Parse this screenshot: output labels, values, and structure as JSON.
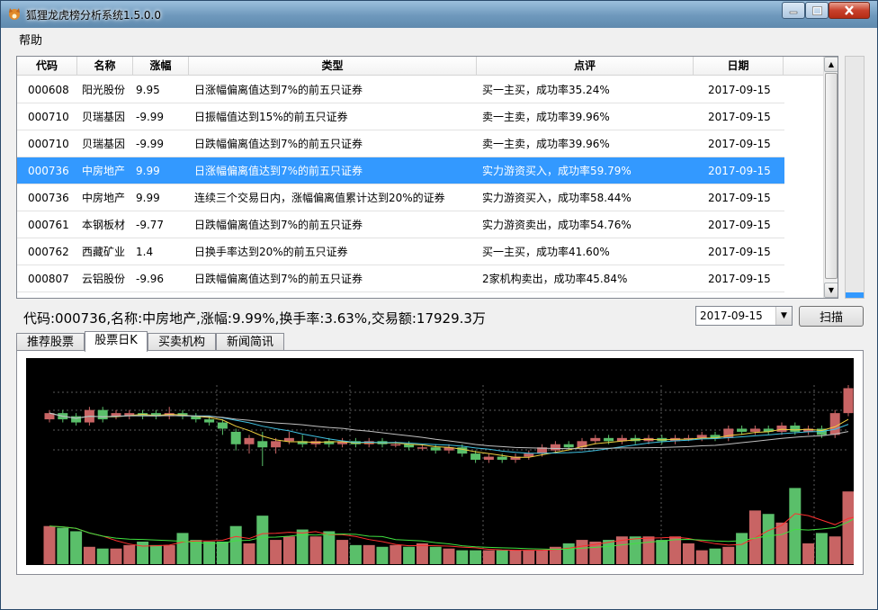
{
  "window": {
    "title": "狐狸龙虎榜分析系统1.5.0.0"
  },
  "menu": {
    "help": "帮助"
  },
  "table": {
    "columns": [
      "代码",
      "名称",
      "涨幅",
      "类型",
      "点评",
      "日期"
    ],
    "rows": [
      {
        "code": "000608",
        "name": "阳光股份",
        "change": "9.95",
        "type": "日涨幅偏离值达到7%的前五只证券",
        "comment": "买一主买，成功率35.24%",
        "date": "2017-09-15",
        "selected": false
      },
      {
        "code": "000710",
        "name": "贝瑞基因",
        "change": "-9.99",
        "type": "日振幅值达到15%的前五只证券",
        "comment": "卖一主卖，成功率39.96%",
        "date": "2017-09-15",
        "selected": false
      },
      {
        "code": "000710",
        "name": "贝瑞基因",
        "change": "-9.99",
        "type": "日跌幅偏离值达到7%的前五只证券",
        "comment": "卖一主卖，成功率39.96%",
        "date": "2017-09-15",
        "selected": false
      },
      {
        "code": "000736",
        "name": "中房地产",
        "change": "9.99",
        "type": "日涨幅偏离值达到7%的前五只证券",
        "comment": "实力游资买入，成功率59.79%",
        "date": "2017-09-15",
        "selected": true
      },
      {
        "code": "000736",
        "name": "中房地产",
        "change": "9.99",
        "type": "连续三个交易日内，涨幅偏离值累计达到20%的证券",
        "comment": "实力游资买入，成功率58.44%",
        "date": "2017-09-15",
        "selected": false
      },
      {
        "code": "000761",
        "name": "本钢板材",
        "change": "-9.77",
        "type": "日跌幅偏离值达到7%的前五只证券",
        "comment": "实力游资卖出，成功率54.76%",
        "date": "2017-09-15",
        "selected": false
      },
      {
        "code": "000762",
        "name": "西藏矿业",
        "change": "1.4",
        "type": "日换手率达到20%的前五只证券",
        "comment": "买一主买，成功率41.60%",
        "date": "2017-09-15",
        "selected": false
      },
      {
        "code": "000807",
        "name": "云铝股份",
        "change": "-9.96",
        "type": "日跌幅偏离值达到7%的前五只证券",
        "comment": "2家机构卖出，成功率45.84%",
        "date": "2017-09-15",
        "selected": false
      }
    ]
  },
  "info_line": "代码:000736,名称:中房地产,涨幅:9.99%,换手率:3.63%,交易额:17929.3万",
  "date_select": {
    "value": "2017-09-15"
  },
  "scan_button": "扫描",
  "tabs": [
    "推荐股票",
    "股票日K",
    "买卖机构",
    "新闻简讯"
  ],
  "active_tab": 1,
  "colors": {
    "up": "#c86464",
    "down": "#5abf6a",
    "ma5": "#f0d040",
    "ma10": "#40c0e0",
    "ma20": "#c0c0c0",
    "vol_ma1": "#ff3030",
    "vol_ma2": "#40e040",
    "selection": "#3399ff"
  },
  "kline": {
    "candles": [
      {
        "o": 4.5,
        "c": 4.6,
        "h": 4.65,
        "l": 4.45
      },
      {
        "o": 4.6,
        "c": 4.5,
        "h": 4.65,
        "l": 4.45
      },
      {
        "o": 4.55,
        "c": 4.45,
        "h": 4.6,
        "l": 4.4
      },
      {
        "o": 4.45,
        "c": 4.65,
        "h": 4.7,
        "l": 4.4
      },
      {
        "o": 4.65,
        "c": 4.5,
        "h": 4.7,
        "l": 4.45
      },
      {
        "o": 4.55,
        "c": 4.6,
        "h": 4.65,
        "l": 4.5
      },
      {
        "o": 4.55,
        "c": 4.6,
        "h": 4.65,
        "l": 4.5
      },
      {
        "o": 4.6,
        "c": 4.55,
        "h": 4.65,
        "l": 4.5
      },
      {
        "o": 4.6,
        "c": 4.55,
        "h": 4.65,
        "l": 4.5
      },
      {
        "o": 4.55,
        "c": 4.6,
        "h": 4.7,
        "l": 4.5
      },
      {
        "o": 4.6,
        "c": 4.55,
        "h": 4.65,
        "l": 4.5
      },
      {
        "o": 4.55,
        "c": 4.5,
        "h": 4.6,
        "l": 4.45
      },
      {
        "o": 4.5,
        "c": 4.45,
        "h": 4.55,
        "l": 4.4
      },
      {
        "o": 4.45,
        "c": 4.35,
        "h": 4.5,
        "l": 4.25
      },
      {
        "o": 4.3,
        "c": 4.1,
        "h": 4.35,
        "l": 4.0
      },
      {
        "o": 4.1,
        "c": 4.2,
        "h": 4.25,
        "l": 3.95
      },
      {
        "o": 4.15,
        "c": 4.05,
        "h": 4.3,
        "l": 3.75
      },
      {
        "o": 4.05,
        "c": 4.15,
        "h": 4.2,
        "l": 3.95
      },
      {
        "o": 4.15,
        "c": 4.2,
        "h": 4.3,
        "l": 4.1
      },
      {
        "o": 4.15,
        "c": 4.1,
        "h": 4.25,
        "l": 4.05
      },
      {
        "o": 4.1,
        "c": 4.15,
        "h": 4.2,
        "l": 4.05
      },
      {
        "o": 4.15,
        "c": 4.1,
        "h": 4.2,
        "l": 4.05
      },
      {
        "o": 4.1,
        "c": 4.15,
        "h": 4.2,
        "l": 4.05
      },
      {
        "o": 4.15,
        "c": 4.1,
        "h": 4.2,
        "l": 4.05
      },
      {
        "o": 4.1,
        "c": 4.15,
        "h": 4.2,
        "l": 4.05
      },
      {
        "o": 4.15,
        "c": 4.1,
        "h": 4.2,
        "l": 4.05
      },
      {
        "o": 4.1,
        "c": 4.1,
        "h": 4.15,
        "l": 4.05
      },
      {
        "o": 4.1,
        "c": 4.05,
        "h": 4.15,
        "l": 4.0
      },
      {
        "o": 4.05,
        "c": 4.05,
        "h": 4.1,
        "l": 4.0
      },
      {
        "o": 4.05,
        "c": 4.0,
        "h": 4.1,
        "l": 3.95
      },
      {
        "o": 4.0,
        "c": 4.05,
        "h": 4.1,
        "l": 3.95
      },
      {
        "o": 4.05,
        "c": 3.95,
        "h": 4.1,
        "l": 3.9
      },
      {
        "o": 3.95,
        "c": 3.85,
        "h": 4.0,
        "l": 3.8
      },
      {
        "o": 3.85,
        "c": 3.9,
        "h": 3.95,
        "l": 3.8
      },
      {
        "o": 3.9,
        "c": 3.85,
        "h": 3.95,
        "l": 3.8
      },
      {
        "o": 3.85,
        "c": 3.9,
        "h": 3.95,
        "l": 3.8
      },
      {
        "o": 3.9,
        "c": 3.95,
        "h": 4.0,
        "l": 3.85
      },
      {
        "o": 3.95,
        "c": 4.05,
        "h": 4.1,
        "l": 3.9
      },
      {
        "o": 4.0,
        "c": 4.1,
        "h": 4.15,
        "l": 3.95
      },
      {
        "o": 4.1,
        "c": 4.05,
        "h": 4.15,
        "l": 4.0
      },
      {
        "o": 4.05,
        "c": 4.15,
        "h": 4.2,
        "l": 4.0
      },
      {
        "o": 4.15,
        "c": 4.2,
        "h": 4.25,
        "l": 4.1
      },
      {
        "o": 4.2,
        "c": 4.15,
        "h": 4.25,
        "l": 4.1
      },
      {
        "o": 4.15,
        "c": 4.2,
        "h": 4.25,
        "l": 4.1
      },
      {
        "o": 4.2,
        "c": 4.15,
        "h": 4.25,
        "l": 4.1
      },
      {
        "o": 4.15,
        "c": 4.2,
        "h": 4.25,
        "l": 4.1
      },
      {
        "o": 4.2,
        "c": 4.15,
        "h": 4.25,
        "l": 4.1
      },
      {
        "o": 4.15,
        "c": 4.2,
        "h": 4.25,
        "l": 4.1
      },
      {
        "o": 4.2,
        "c": 4.2,
        "h": 4.25,
        "l": 4.15
      },
      {
        "o": 4.2,
        "c": 4.25,
        "h": 4.3,
        "l": 4.15
      },
      {
        "o": 4.25,
        "c": 4.2,
        "h": 4.3,
        "l": 4.15
      },
      {
        "o": 4.2,
        "c": 4.35,
        "h": 4.4,
        "l": 4.15
      },
      {
        "o": 4.35,
        "c": 4.3,
        "h": 4.4,
        "l": 4.25
      },
      {
        "o": 4.3,
        "c": 4.35,
        "h": 4.4,
        "l": 4.25
      },
      {
        "o": 4.35,
        "c": 4.3,
        "h": 4.4,
        "l": 4.25
      },
      {
        "o": 4.3,
        "c": 4.4,
        "h": 4.45,
        "l": 4.25
      },
      {
        "o": 4.4,
        "c": 4.3,
        "h": 4.45,
        "l": 4.25
      },
      {
        "o": 4.3,
        "c": 4.35,
        "h": 4.4,
        "l": 4.25
      },
      {
        "o": 4.35,
        "c": 4.25,
        "h": 4.4,
        "l": 4.2
      },
      {
        "o": 4.25,
        "c": 4.6,
        "h": 4.65,
        "l": 4.2
      },
      {
        "o": 4.6,
        "c": 5.0,
        "h": 5.05,
        "l": 4.55
      }
    ],
    "volume": [
      22,
      21,
      19,
      10,
      9,
      9,
      11,
      13,
      11,
      11,
      18,
      14,
      13,
      13,
      22,
      12,
      28,
      14,
      16,
      20,
      16,
      19,
      14,
      11,
      11,
      10,
      11,
      10,
      12,
      10,
      9,
      8,
      8,
      8,
      8,
      8,
      8,
      8,
      10,
      12,
      14,
      13,
      14,
      16,
      16,
      16,
      14,
      16,
      12,
      8,
      9,
      10,
      18,
      31,
      29,
      24,
      44,
      12,
      18,
      16,
      42,
      52
    ]
  }
}
